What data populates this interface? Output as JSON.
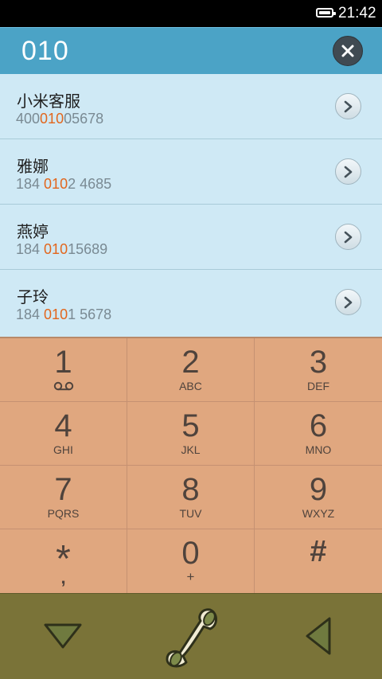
{
  "status_bar": {
    "time": "21:42"
  },
  "search": {
    "query": "010",
    "clear_icon": "close-icon"
  },
  "results": [
    {
      "name": "小米客服",
      "number_pre": "400",
      "number_match": "010",
      "number_post": "05678"
    },
    {
      "name": "雅娜",
      "number_pre": "184 ",
      "number_match": "010",
      "number_post": "2 4685"
    },
    {
      "name": "燕婷",
      "number_pre": "184 ",
      "number_match": "010",
      "number_post": "15689"
    },
    {
      "name": "子玲",
      "number_pre": "184 ",
      "number_match": "010",
      "number_post": "1 5678"
    }
  ],
  "keypad": [
    {
      "digit": "1",
      "letters": ""
    },
    {
      "digit": "2",
      "letters": "ABC"
    },
    {
      "digit": "3",
      "letters": "DEF"
    },
    {
      "digit": "4",
      "letters": "GHI"
    },
    {
      "digit": "5",
      "letters": "JKL"
    },
    {
      "digit": "6",
      "letters": "MNO"
    },
    {
      "digit": "7",
      "letters": "PQRS"
    },
    {
      "digit": "8",
      "letters": "TUV"
    },
    {
      "digit": "9",
      "letters": "WXYZ"
    },
    {
      "digit": "*",
      "letters": ","
    },
    {
      "digit": "0",
      "letters": "+"
    },
    {
      "digit": "#",
      "letters": ""
    }
  ],
  "colors": {
    "highlight": "#e2661d",
    "header": "#4ba3c6",
    "list_bg": "#cfe9f5",
    "keypad_bg": "#e0a77f",
    "bottom_bar": "#7a7338"
  },
  "icons": {
    "voicemail": "voicemail-icon",
    "hide_keypad": "triangle-down-icon",
    "call": "phone-handset-icon",
    "back": "triangle-left-icon"
  }
}
